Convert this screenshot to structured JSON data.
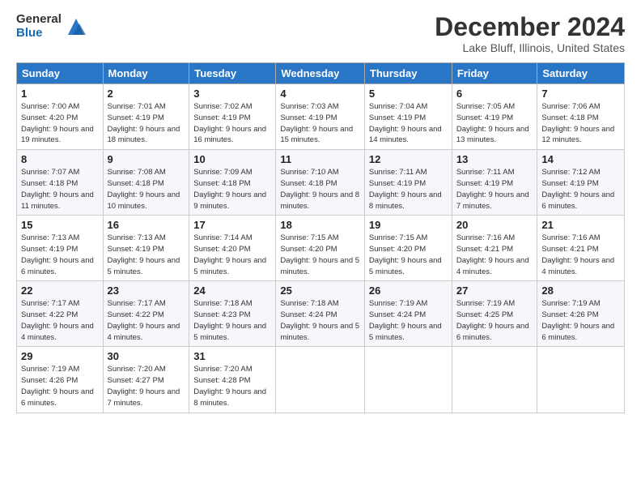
{
  "logo": {
    "general": "General",
    "blue": "Blue"
  },
  "header": {
    "month_title": "December 2024",
    "location": "Lake Bluff, Illinois, United States"
  },
  "days_of_week": [
    "Sunday",
    "Monday",
    "Tuesday",
    "Wednesday",
    "Thursday",
    "Friday",
    "Saturday"
  ],
  "weeks": [
    [
      {
        "day": "1",
        "sunrise": "7:00 AM",
        "sunset": "4:20 PM",
        "daylight": "9 hours and 19 minutes."
      },
      {
        "day": "2",
        "sunrise": "7:01 AM",
        "sunset": "4:19 PM",
        "daylight": "9 hours and 18 minutes."
      },
      {
        "day": "3",
        "sunrise": "7:02 AM",
        "sunset": "4:19 PM",
        "daylight": "9 hours and 16 minutes."
      },
      {
        "day": "4",
        "sunrise": "7:03 AM",
        "sunset": "4:19 PM",
        "daylight": "9 hours and 15 minutes."
      },
      {
        "day": "5",
        "sunrise": "7:04 AM",
        "sunset": "4:19 PM",
        "daylight": "9 hours and 14 minutes."
      },
      {
        "day": "6",
        "sunrise": "7:05 AM",
        "sunset": "4:19 PM",
        "daylight": "9 hours and 13 minutes."
      },
      {
        "day": "7",
        "sunrise": "7:06 AM",
        "sunset": "4:18 PM",
        "daylight": "9 hours and 12 minutes."
      }
    ],
    [
      {
        "day": "8",
        "sunrise": "7:07 AM",
        "sunset": "4:18 PM",
        "daylight": "9 hours and 11 minutes."
      },
      {
        "day": "9",
        "sunrise": "7:08 AM",
        "sunset": "4:18 PM",
        "daylight": "9 hours and 10 minutes."
      },
      {
        "day": "10",
        "sunrise": "7:09 AM",
        "sunset": "4:18 PM",
        "daylight": "9 hours and 9 minutes."
      },
      {
        "day": "11",
        "sunrise": "7:10 AM",
        "sunset": "4:18 PM",
        "daylight": "9 hours and 8 minutes."
      },
      {
        "day": "12",
        "sunrise": "7:11 AM",
        "sunset": "4:19 PM",
        "daylight": "9 hours and 8 minutes."
      },
      {
        "day": "13",
        "sunrise": "7:11 AM",
        "sunset": "4:19 PM",
        "daylight": "9 hours and 7 minutes."
      },
      {
        "day": "14",
        "sunrise": "7:12 AM",
        "sunset": "4:19 PM",
        "daylight": "9 hours and 6 minutes."
      }
    ],
    [
      {
        "day": "15",
        "sunrise": "7:13 AM",
        "sunset": "4:19 PM",
        "daylight": "9 hours and 6 minutes."
      },
      {
        "day": "16",
        "sunrise": "7:13 AM",
        "sunset": "4:19 PM",
        "daylight": "9 hours and 5 minutes."
      },
      {
        "day": "17",
        "sunrise": "7:14 AM",
        "sunset": "4:20 PM",
        "daylight": "9 hours and 5 minutes."
      },
      {
        "day": "18",
        "sunrise": "7:15 AM",
        "sunset": "4:20 PM",
        "daylight": "9 hours and 5 minutes."
      },
      {
        "day": "19",
        "sunrise": "7:15 AM",
        "sunset": "4:20 PM",
        "daylight": "9 hours and 5 minutes."
      },
      {
        "day": "20",
        "sunrise": "7:16 AM",
        "sunset": "4:21 PM",
        "daylight": "9 hours and 4 minutes."
      },
      {
        "day": "21",
        "sunrise": "7:16 AM",
        "sunset": "4:21 PM",
        "daylight": "9 hours and 4 minutes."
      }
    ],
    [
      {
        "day": "22",
        "sunrise": "7:17 AM",
        "sunset": "4:22 PM",
        "daylight": "9 hours and 4 minutes."
      },
      {
        "day": "23",
        "sunrise": "7:17 AM",
        "sunset": "4:22 PM",
        "daylight": "9 hours and 4 minutes."
      },
      {
        "day": "24",
        "sunrise": "7:18 AM",
        "sunset": "4:23 PM",
        "daylight": "9 hours and 5 minutes."
      },
      {
        "day": "25",
        "sunrise": "7:18 AM",
        "sunset": "4:24 PM",
        "daylight": "9 hours and 5 minutes."
      },
      {
        "day": "26",
        "sunrise": "7:19 AM",
        "sunset": "4:24 PM",
        "daylight": "9 hours and 5 minutes."
      },
      {
        "day": "27",
        "sunrise": "7:19 AM",
        "sunset": "4:25 PM",
        "daylight": "9 hours and 6 minutes."
      },
      {
        "day": "28",
        "sunrise": "7:19 AM",
        "sunset": "4:26 PM",
        "daylight": "9 hours and 6 minutes."
      }
    ],
    [
      {
        "day": "29",
        "sunrise": "7:19 AM",
        "sunset": "4:26 PM",
        "daylight": "9 hours and 6 minutes."
      },
      {
        "day": "30",
        "sunrise": "7:20 AM",
        "sunset": "4:27 PM",
        "daylight": "9 hours and 7 minutes."
      },
      {
        "day": "31",
        "sunrise": "7:20 AM",
        "sunset": "4:28 PM",
        "daylight": "9 hours and 8 minutes."
      },
      null,
      null,
      null,
      null
    ]
  ]
}
